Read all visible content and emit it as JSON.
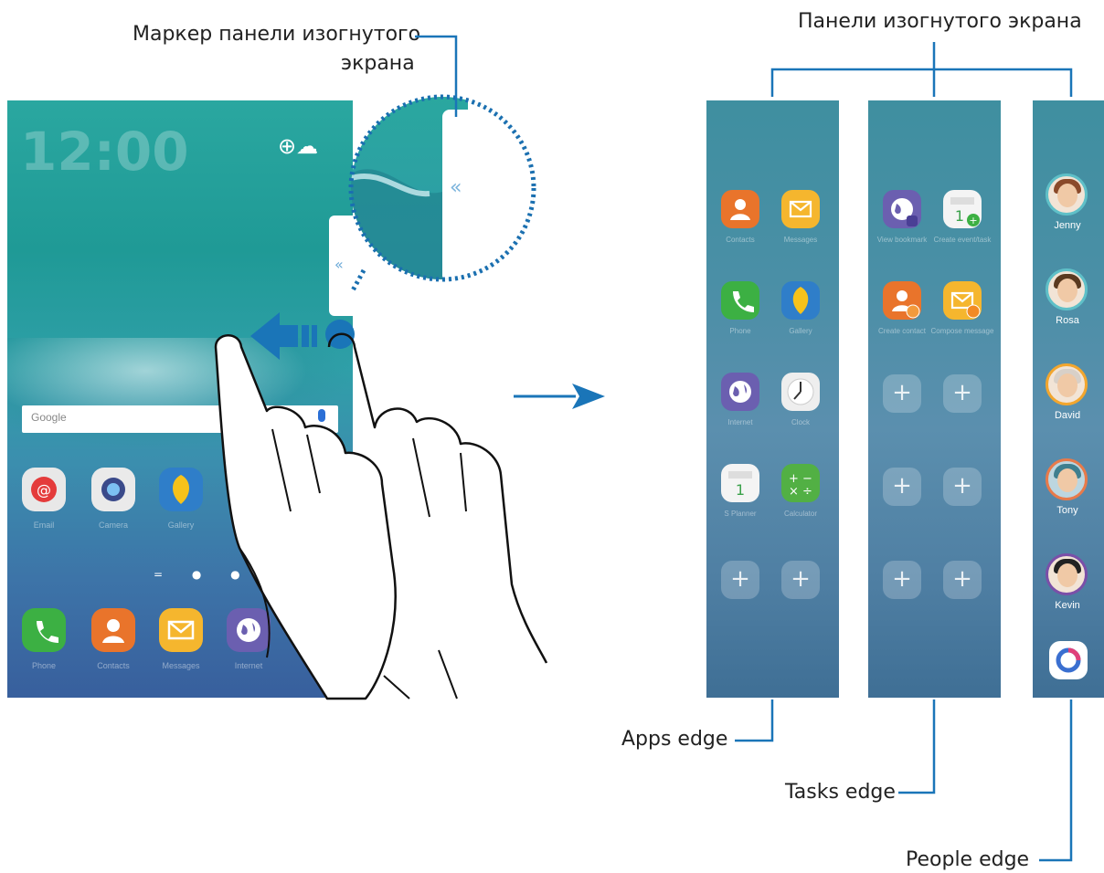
{
  "callouts": {
    "handle_label_line1": "Маркер панели изогнутого",
    "handle_label_line2": "экрана",
    "panels_label": "Панели изогнутого экрана",
    "apps_edge": "Apps edge",
    "tasks_edge": "Tasks edge",
    "people_edge": "People edge"
  },
  "phone": {
    "clock": "12:00",
    "search_brand": "Google",
    "home_apps": [
      "Email",
      "Camera",
      "Gallery"
    ],
    "dock_apps": [
      "Phone",
      "Contacts",
      "Messages",
      "Internet"
    ]
  },
  "apps_edge_panel": {
    "apps": [
      "Contacts",
      "Messages",
      "Phone",
      "Gallery",
      "Internet",
      "Clock",
      "S Planner",
      "Calculator"
    ]
  },
  "tasks_edge_panel": {
    "tasks": [
      "View bookmark",
      "Create event/task",
      "Create contact",
      "Compose message"
    ]
  },
  "people_edge_panel": {
    "people": [
      "Jenny",
      "Rosa",
      "David",
      "Tony",
      "Kevin"
    ]
  },
  "colors": {
    "callout_line": "#1a75b8",
    "arrow": "#1a75b8",
    "magnifier_border": "#1a6fb0"
  },
  "icons": [
    "globe-icon",
    "phone-icon",
    "contact-icon",
    "envelope-icon",
    "clock-icon",
    "calendar-icon",
    "calculator-icon",
    "plus-icon",
    "chevron-left-icon"
  ]
}
